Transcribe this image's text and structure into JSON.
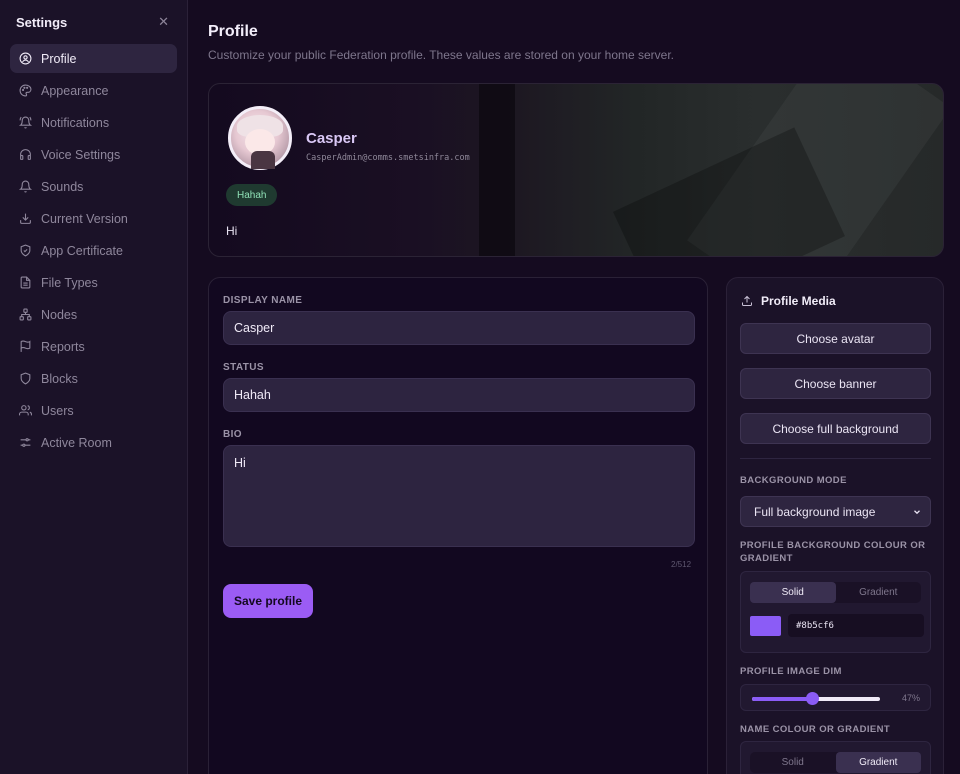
{
  "sidebar": {
    "title": "Settings",
    "items": [
      {
        "label": "Profile",
        "icon": "user-circle-icon"
      },
      {
        "label": "Appearance",
        "icon": "palette-icon"
      },
      {
        "label": "Notifications",
        "icon": "bell-ring-icon"
      },
      {
        "label": "Voice Settings",
        "icon": "headphones-icon"
      },
      {
        "label": "Sounds",
        "icon": "bell-icon"
      },
      {
        "label": "Current Version",
        "icon": "download-icon"
      },
      {
        "label": "App Certificate",
        "icon": "shield-check-icon"
      },
      {
        "label": "File Types",
        "icon": "file-icon"
      },
      {
        "label": "Nodes",
        "icon": "network-icon"
      },
      {
        "label": "Reports",
        "icon": "flag-icon"
      },
      {
        "label": "Blocks",
        "icon": "shield-icon"
      },
      {
        "label": "Users",
        "icon": "users-icon"
      },
      {
        "label": "Active Room",
        "icon": "sliders-icon"
      }
    ]
  },
  "header": {
    "title": "Profile",
    "subtitle": "Customize your public Federation profile. These values are stored on your home server."
  },
  "banner": {
    "name": "Casper",
    "handle": "CasperAdmin@comms.smetsinfra.com",
    "status": "Hahah",
    "bio": "Hi"
  },
  "form": {
    "display_name_label": "DISPLAY NAME",
    "display_name_value": "Casper",
    "status_label": "STATUS",
    "status_value": "Hahah",
    "bio_label": "BIO",
    "bio_value": "Hi",
    "bio_counter": "2/512",
    "save_label": "Save profile"
  },
  "media": {
    "title": "Profile Media",
    "choose_avatar": "Choose avatar",
    "choose_banner": "Choose banner",
    "choose_background": "Choose full background",
    "background_mode_label": "BACKGROUND MODE",
    "background_mode_value": "Full background image",
    "bg_colour_label": "PROFILE BACKGROUND COLOUR OR GRADIENT",
    "solid_label": "Solid",
    "gradient_label": "Gradient",
    "bg_colour_hex": "#8b5cf6",
    "image_dim_label": "PROFILE IMAGE DIM",
    "image_dim_value": 47,
    "image_dim_text": "47%",
    "name_colour_label": "NAME COLOUR OR GRADIENT"
  },
  "colors": {
    "accent": "#8b5cf6",
    "button": "#9b5cf4",
    "status_badge_text": "#8fe0b6"
  }
}
